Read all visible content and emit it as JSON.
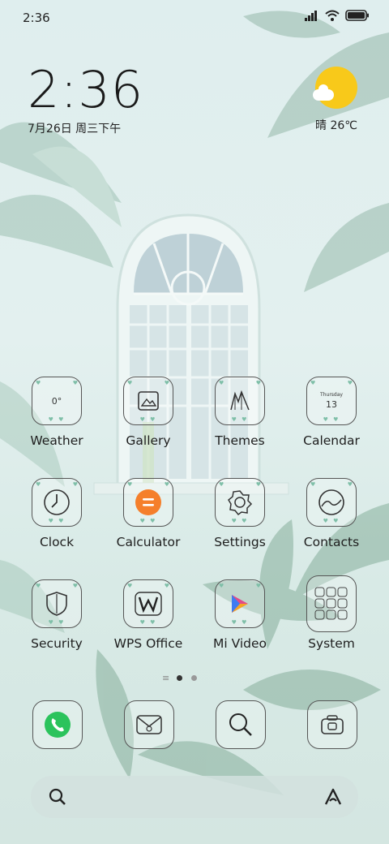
{
  "status_bar": {
    "time": "2:36",
    "icons": [
      "signal-icon",
      "wifi-icon",
      "battery-icon"
    ]
  },
  "clock_widget": {
    "time": "2:36",
    "date": "7月26日 周三下午"
  },
  "weather_widget": {
    "condition_icon": "sun-cloud-icon",
    "text": "晴 26℃"
  },
  "weather_app_icon": {
    "temp": "0°"
  },
  "calendar_app_icon": {
    "weekday": "Thursday",
    "day": "13"
  },
  "apps": [
    {
      "label": "Weather"
    },
    {
      "label": "Gallery"
    },
    {
      "label": "Themes"
    },
    {
      "label": "Calendar"
    },
    {
      "label": "Clock"
    },
    {
      "label": "Calculator"
    },
    {
      "label": "Settings"
    },
    {
      "label": "Contacts"
    },
    {
      "label": "Security"
    },
    {
      "label": "WPS Office"
    },
    {
      "label": "Mi Video"
    },
    {
      "label": "System"
    }
  ],
  "pager": {
    "pages": 2,
    "current": 1
  },
  "dock": [
    "phone-icon",
    "messages-icon",
    "browser-search-icon",
    "camera-icon"
  ],
  "search_bar": {
    "left_icon": "search-icon",
    "right_icon": "assistant-a-icon"
  },
  "colors": {
    "background": "#dfeeee",
    "sun": "#f8c91a",
    "phone_green": "#2bc35c",
    "calculator_orange": "#f57f2b",
    "accent_heart": "#7fbfa8"
  }
}
